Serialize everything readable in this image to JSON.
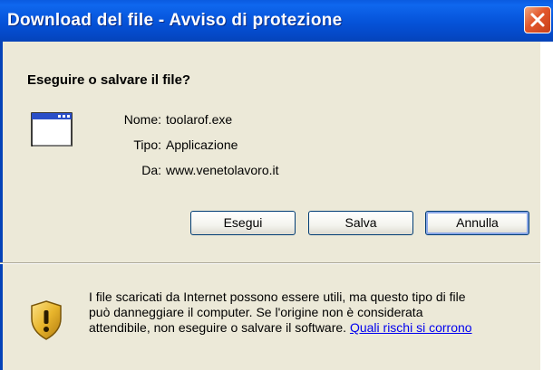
{
  "window": {
    "title": "Download del file - Avviso di protezione"
  },
  "dialog": {
    "question": "Eseguire o salvare il file?",
    "fields": [
      {
        "label": "Nome:",
        "value": "toolarof.exe"
      },
      {
        "label": "Tipo:",
        "value": "Applicazione"
      },
      {
        "label": "Da:",
        "value": "www.venetolavoro.it"
      }
    ],
    "buttons": {
      "run": "Esegui",
      "save": "Salva",
      "cancel": "Annulla"
    },
    "warning": {
      "line1": "I file scaricati da Internet possono essere utili, ma questo tipo di file",
      "line2": "può danneggiare il computer. Se l'origine non è considerata",
      "line3": "attendibile, non eseguire o salvare il software.",
      "link": "Quali rischi si corrono"
    }
  },
  "icons": {
    "close": "close-icon",
    "application": "application-window-icon",
    "security": "security-shield-icon"
  },
  "colors": {
    "titlebar": "#0552D8",
    "dialog_bg": "#ECE9D8",
    "close_button": "#E2562B",
    "link": "#0000EE",
    "shield": "#E8B52C"
  }
}
